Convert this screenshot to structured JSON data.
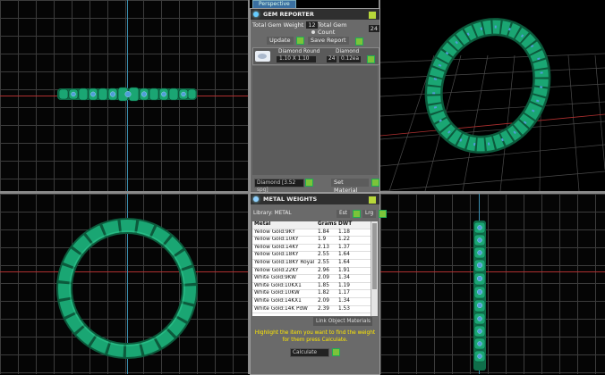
{
  "viewport_tab": "Perspective",
  "gem_reporter": {
    "title": "GEM REPORTER",
    "total_weight_label": "Total Gem Weight",
    "total_weight_value": "12",
    "total_count_label": "Total Gem Count",
    "total_count_value": "24",
    "update_label": "Update",
    "save_report_label": "Save Report",
    "gem_name": "Diamond Round",
    "gem_size": "1.10 X 1.10",
    "gem_count": "24",
    "gem_weight": "0.12ea",
    "gem_col_header": "Diamond",
    "material_dropdown": "Diamond  [3.52 spg]",
    "set_material_label": "Set Material"
  },
  "metal_weights": {
    "title": "METAL WEIGHTS",
    "library_label": "Library: METAL",
    "btn1": "Est",
    "btn2": "Lrg",
    "columns": [
      "Metal",
      "Grams",
      "DWT"
    ],
    "rows": [
      [
        "Yellow Gold:9KY",
        "1.84",
        "1.18"
      ],
      [
        "Yellow Gold:10KY",
        "1.9",
        "1.22"
      ],
      [
        "Yellow Gold:14KY",
        "2.13",
        "1.37"
      ],
      [
        "Yellow Gold:18KY",
        "2.55",
        "1.64"
      ],
      [
        "Yellow Gold:18KY Royal",
        "2.55",
        "1.64"
      ],
      [
        "Yellow Gold:22KY",
        "2.96",
        "1.91"
      ],
      [
        "White Gold:9KW",
        "2.09",
        "1.34"
      ],
      [
        "White Gold:10KX1",
        "1.85",
        "1.19"
      ],
      [
        "White Gold:10KW",
        "1.82",
        "1.17"
      ],
      [
        "White Gold:14KX1",
        "2.09",
        "1.34"
      ],
      [
        "White Gold:14K PdW",
        "2.39",
        "1.53"
      ]
    ],
    "link_objects": "Link Object Materials",
    "instruction_line1": "Highlight the item you want to find the weight",
    "instruction_line2": "for them press Calculate.",
    "calculate_label": "Calculate"
  },
  "colors": {
    "ring_green": "#1aa673",
    "ring_dark": "#0c5a3c",
    "gem_blue": "#4f9ed8",
    "panel_bg": "#6a6a6a",
    "note_yellow": "#ffe800"
  }
}
